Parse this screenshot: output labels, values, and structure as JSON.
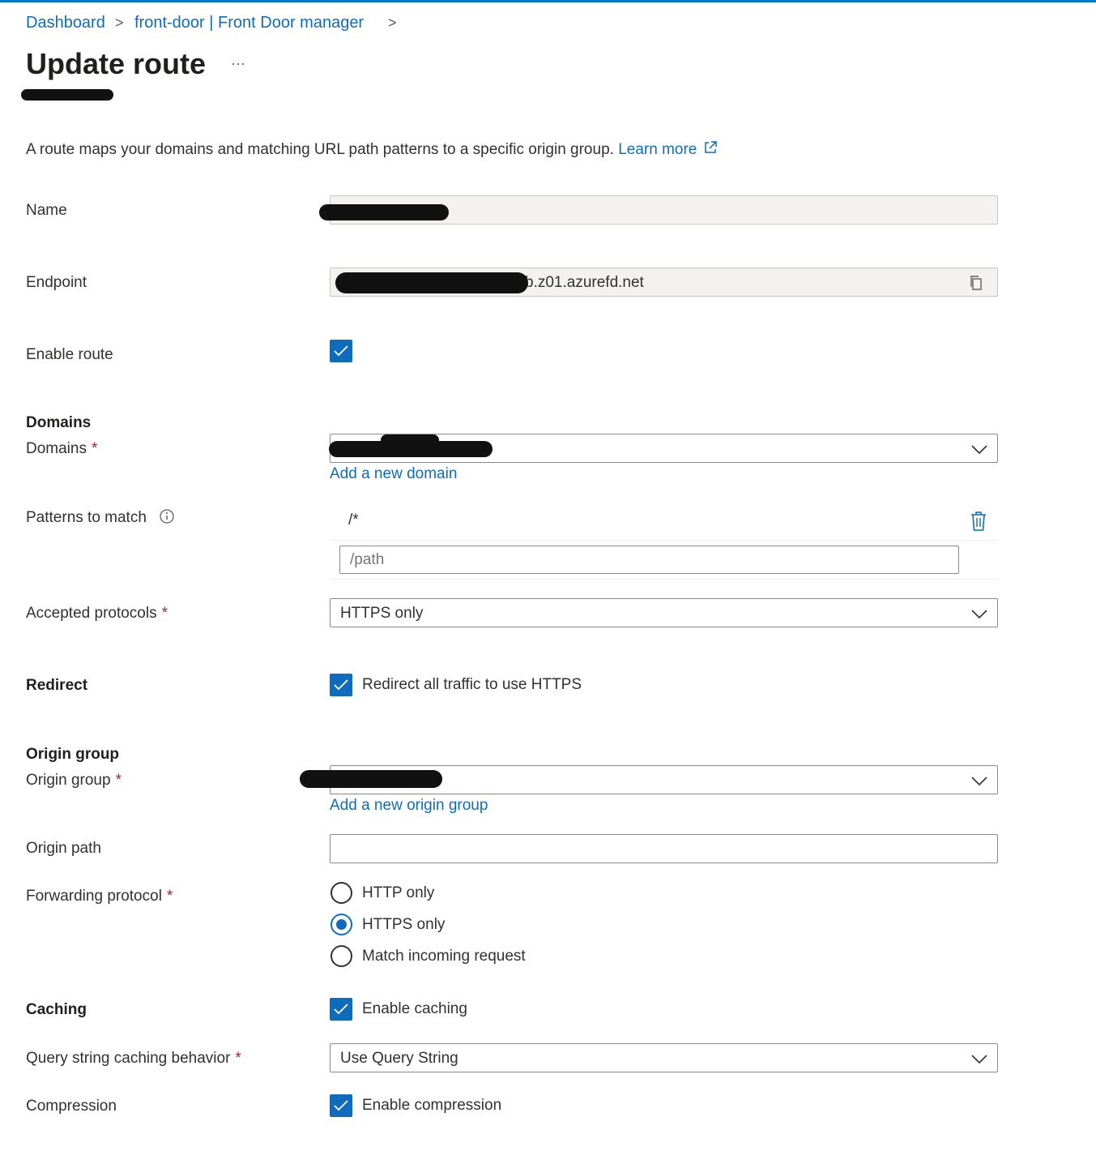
{
  "breadcrumb": {
    "items": [
      "Dashboard",
      "front-door | Front Door manager"
    ],
    "separator": ">"
  },
  "page": {
    "title": "Update route",
    "more_label": "···",
    "description": "A route maps your domains and matching URL path patterns to a specific origin group.",
    "learn_more": "Learn more"
  },
  "form": {
    "name": {
      "label": "Name",
      "value": ""
    },
    "endpoint": {
      "label": "Endpoint",
      "value": "b.z01.azurefd.net"
    },
    "enable_route": {
      "label": "Enable route",
      "checked": true
    },
    "domains_section": "Domains",
    "domains": {
      "label": "Domains",
      "required": "*",
      "value": "",
      "add_link": "Add a new domain"
    },
    "patterns": {
      "label": "Patterns to match",
      "items": [
        "/*"
      ],
      "placeholder": "/path"
    },
    "accepted_protocols": {
      "label": "Accepted protocols",
      "required": "*",
      "value": "HTTPS only"
    },
    "redirect": {
      "section": "Redirect",
      "option": "Redirect all traffic to use HTTPS",
      "checked": true
    },
    "origin_group_section": "Origin group",
    "origin_group": {
      "label": "Origin group",
      "required": "*",
      "value": "",
      "add_link": "Add a new origin group"
    },
    "origin_path": {
      "label": "Origin path",
      "value": ""
    },
    "forwarding_protocol": {
      "label": "Forwarding protocol",
      "required": "*",
      "options": [
        "HTTP only",
        "HTTPS only",
        "Match incoming request"
      ],
      "selected": "HTTPS only"
    },
    "caching": {
      "section": "Caching",
      "option": "Enable caching",
      "checked": true
    },
    "query_string": {
      "label": "Query string caching behavior",
      "required": "*",
      "value": "Use Query String"
    },
    "compression": {
      "label": "Compression",
      "option": "Enable compression",
      "checked": true
    }
  },
  "colors": {
    "accent": "#0f6cbd",
    "required": "#a4262c",
    "text": "#323130"
  }
}
